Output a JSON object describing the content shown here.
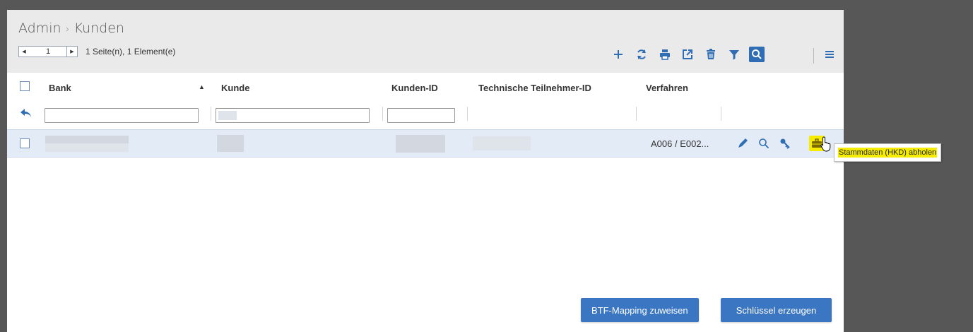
{
  "breadcrumb": {
    "root": "Admin",
    "separator": "›",
    "current": "Kunden"
  },
  "pager": {
    "page": "1",
    "info": "1 Seite(n), 1 Element(e)"
  },
  "toolbar": {
    "icons": [
      "plus-icon",
      "refresh-icon",
      "print-icon",
      "export-icon",
      "delete-icon",
      "filter-icon",
      "search-icon",
      "menu-icon"
    ]
  },
  "table": {
    "columns": {
      "bank": "Bank",
      "kunde": "Kunde",
      "kunden_id": "Kunden-ID",
      "tech_id": "Technische Teilnehmer-ID",
      "verfahren": "Verfahren"
    },
    "sort": {
      "column": "Bank",
      "direction": "ascending"
    },
    "rows": [
      {
        "bank": "",
        "kunde": "",
        "kunden_id": "",
        "tech_id": "",
        "verfahren": "A006 / E002..."
      }
    ]
  },
  "tooltip": {
    "text": "Stammdaten (HKD) abholen"
  },
  "buttons": {
    "btf_mapping": "BTF-Mapping zuweisen",
    "key_generate": "Schlüssel erzeugen"
  },
  "colors": {
    "accent": "#2f6db4",
    "highlight": "#f5ec00",
    "row_selected": "#e3ebf6"
  }
}
